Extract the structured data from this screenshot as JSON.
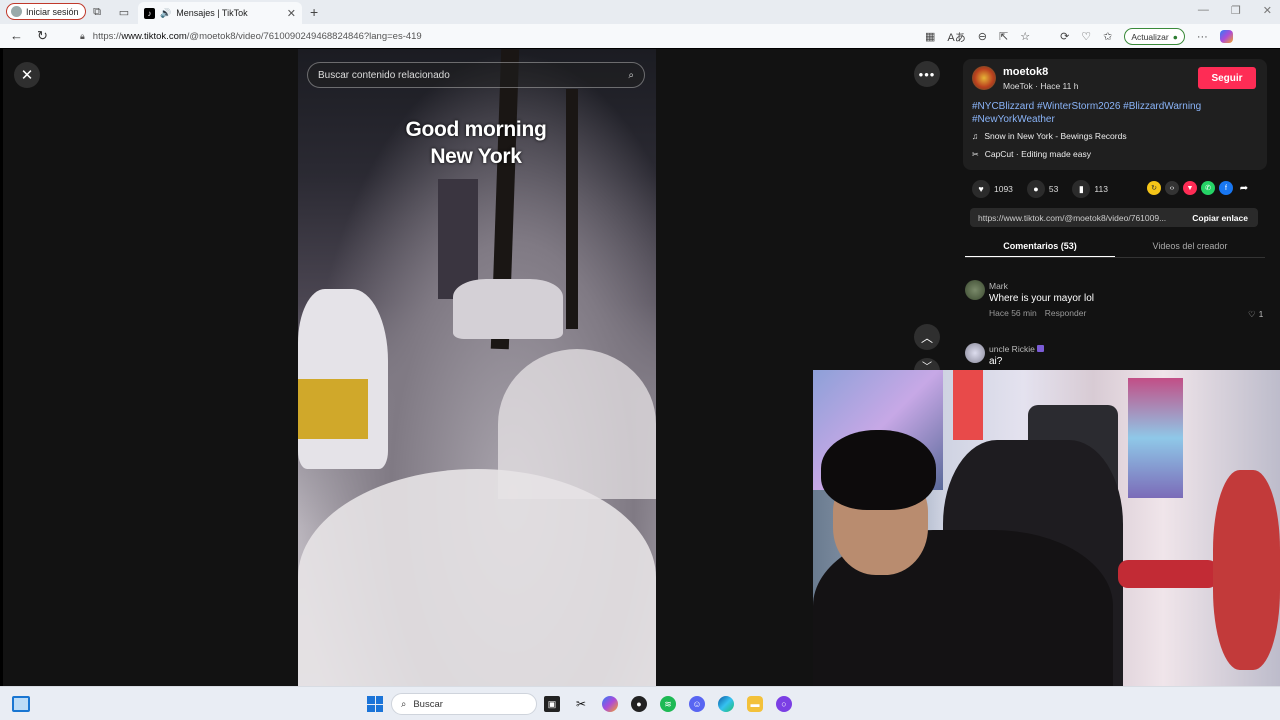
{
  "browser": {
    "signin_label": "Iniciar sesión",
    "tab_title": "Mensajes | TikTok",
    "url_domain": "www.tiktok.com",
    "url_prefix": "https://",
    "url_path": "/@moetok8/video/7610090249468824846?lang=es-419",
    "update_label": "Actualizar"
  },
  "video": {
    "search_placeholder": "Buscar contenido relacionado",
    "caption_line1": "Good morning",
    "caption_line2": "New York"
  },
  "creator": {
    "username": "moetok8",
    "display_name": "MoeTok",
    "time_ago": "Hace 11 h",
    "follow_label": "Seguir",
    "hashtags": "#NYCBlizzard #WinterStorm2026 #BlizzardWarning #NewYorkWeather",
    "music": "Snow in New York - Bewings Records",
    "capcut": "CapCut · Editing made easy"
  },
  "stats": {
    "likes": "1093",
    "comments": "53",
    "saves": "113"
  },
  "link": {
    "url": "https://www.tiktok.com/@moetok8/video/761009...",
    "copy_label": "Copiar enlace"
  },
  "tabs": {
    "comments": "Comentarios (53)",
    "creator_videos": "Videos del creador"
  },
  "comments": [
    {
      "user": "Mark",
      "text": "Where is your mayor lol",
      "time": "Hace 56 min",
      "reply": "Responder",
      "likes": "1"
    },
    {
      "user": "uncle Rickie",
      "text": "ai?"
    }
  ],
  "taskbar": {
    "search_placeholder": "Buscar"
  },
  "colors": {
    "accent": "#fe2c55",
    "hashtag": "#8ab4f8",
    "panel_bg": "#121212",
    "windows_blue": "#1b74d8"
  }
}
